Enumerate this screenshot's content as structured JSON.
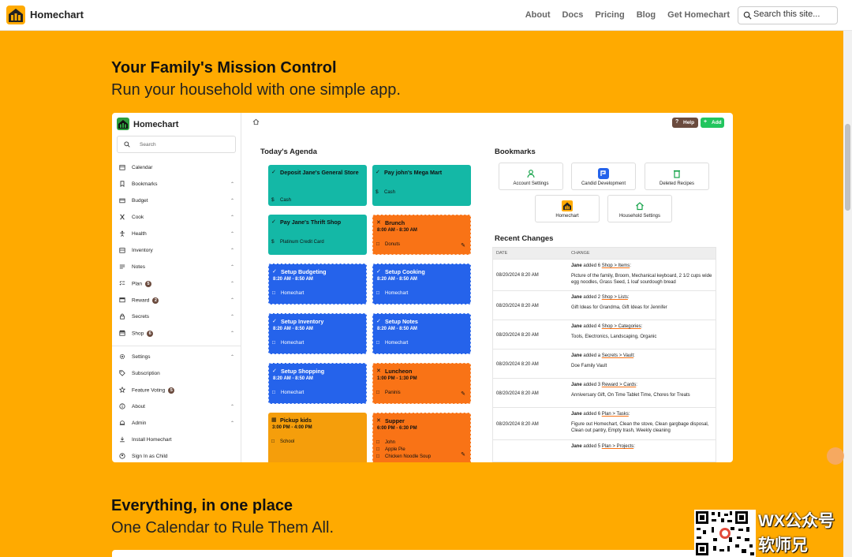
{
  "site": {
    "brand": "Homechart",
    "nav": [
      "About",
      "Docs",
      "Pricing",
      "Blog",
      "Get Homechart"
    ],
    "search_placeholder": "Search this site..."
  },
  "hero": {
    "title": "Your Family's Mission Control",
    "subtitle": "Run your household with one simple app."
  },
  "section2": {
    "title": "Everything, in one place",
    "subtitle": "One Calendar to Rule Them All."
  },
  "app": {
    "brand": "Homechart",
    "search": "Search",
    "help_label": "Help",
    "add_label": "Add",
    "sidebar": [
      {
        "label": "Calendar",
        "icon": "calendar-icon",
        "chev": false,
        "badge": ""
      },
      {
        "label": "Bookmarks",
        "icon": "bookmark-icon",
        "chev": true,
        "badge": ""
      },
      {
        "label": "Budget",
        "icon": "budget-icon",
        "chev": true,
        "badge": ""
      },
      {
        "label": "Cook",
        "icon": "utensils-icon",
        "chev": true,
        "badge": ""
      },
      {
        "label": "Health",
        "icon": "health-icon",
        "chev": true,
        "badge": ""
      },
      {
        "label": "Inventory",
        "icon": "inventory-icon",
        "chev": true,
        "badge": ""
      },
      {
        "label": "Notes",
        "icon": "notes-icon",
        "chev": true,
        "badge": ""
      },
      {
        "label": "Plan",
        "icon": "plan-icon",
        "chev": true,
        "badge": "5"
      },
      {
        "label": "Reward",
        "icon": "reward-icon",
        "chev": true,
        "badge": "2"
      },
      {
        "label": "Secrets",
        "icon": "lock-icon",
        "chev": true,
        "badge": ""
      },
      {
        "label": "Shop",
        "icon": "shop-icon",
        "chev": true,
        "badge": "6"
      },
      {
        "label": "Settings",
        "icon": "gear-icon",
        "chev": true,
        "badge": ""
      },
      {
        "label": "Subscription",
        "icon": "tag-icon",
        "chev": false,
        "badge": ""
      },
      {
        "label": "Feature Voting",
        "icon": "star-icon",
        "chev": false,
        "badge": "5"
      },
      {
        "label": "About",
        "icon": "info-icon",
        "chev": true,
        "badge": ""
      },
      {
        "label": "Admin",
        "icon": "admin-icon",
        "chev": true,
        "badge": ""
      },
      {
        "label": "Install Homechart",
        "icon": "download-icon",
        "chev": false,
        "badge": ""
      },
      {
        "label": "Sign In as Child",
        "icon": "child-icon",
        "chev": false,
        "badge": ""
      }
    ],
    "agenda": {
      "title": "Today's Agenda",
      "cards": [
        {
          "title": "Deposit Jane's General Store",
          "time": "",
          "lines": [
            "Cash"
          ],
          "color": "teal"
        },
        {
          "title": "Pay john's Mega Mart",
          "time": "",
          "lines": [
            "Cash"
          ],
          "color": "teal"
        },
        {
          "title": "Pay Jane's Thrift Shop",
          "time": "",
          "lines": [
            "Platinum Credit Card"
          ],
          "color": "teal"
        },
        {
          "title": "Brunch",
          "time": "8:00 AM - 8:30 AM",
          "lines": [
            "Donuts"
          ],
          "color": "orange"
        },
        {
          "title": "Setup Budgeting",
          "time": "8:20 AM - 8:50 AM",
          "lines": [
            "Homechart"
          ],
          "color": "blue"
        },
        {
          "title": "Setup Cooking",
          "time": "8:20 AM - 8:50 AM",
          "lines": [
            "Homechart"
          ],
          "color": "blue"
        },
        {
          "title": "Setup Inventory",
          "time": "8:20 AM - 8:50 AM",
          "lines": [
            "Homechart"
          ],
          "color": "blue"
        },
        {
          "title": "Setup Notes",
          "time": "8:20 AM - 8:50 AM",
          "lines": [
            "Homechart"
          ],
          "color": "blue"
        },
        {
          "title": "Setup Shopping",
          "time": "8:20 AM - 8:50 AM",
          "lines": [
            "Homechart"
          ],
          "color": "blue"
        },
        {
          "title": "Luncheon",
          "time": "1:00 PM - 1:30 PM",
          "lines": [
            "Paninis"
          ],
          "color": "orange"
        },
        {
          "title": "Pickup kids",
          "time": "3:00 PM - 4:00 PM",
          "lines": [
            "School"
          ],
          "color": "yellow"
        },
        {
          "title": "Supper",
          "time": "6:00 PM - 6:30 PM",
          "lines": [
            "John",
            "Apple Pie",
            "Chicken Noodle Soup"
          ],
          "color": "orange"
        }
      ]
    },
    "bookmarks": {
      "title": "Bookmarks",
      "items": [
        {
          "label": "Account Settings",
          "icon": "user-icon"
        },
        {
          "label": "Candid Development",
          "icon": "candid-icon"
        },
        {
          "label": "Deleted Recipes",
          "icon": "trash-icon"
        },
        {
          "label": "Homechart",
          "icon": "homechart-logo-icon"
        },
        {
          "label": "Household Settings",
          "icon": "house-icon"
        }
      ]
    },
    "recent": {
      "title": "Recent Changes",
      "col_date": "DATE",
      "col_change": "CHANGE",
      "rows": [
        {
          "date": "08/20/2024 8:20 AM",
          "who": "Jane",
          "verb": "added 6",
          "link": "Shop > Items",
          "details": "Picture of the family, Broom, Mechanical keyboard, 2 1/2 cups wide egg noodles, Grass Seed, 1 loaf sourdough bread"
        },
        {
          "date": "08/20/2024 8:20 AM",
          "who": "Jane",
          "verb": "added 2",
          "link": "Shop > Lists",
          "details": "Gift Ideas for Grandma, Gift Ideas for Jennifer"
        },
        {
          "date": "08/20/2024 8:20 AM",
          "who": "Jane",
          "verb": "added 4",
          "link": "Shop > Categories",
          "details": "Tools, Electronics, Landscaping, Organic"
        },
        {
          "date": "08/20/2024 8:20 AM",
          "who": "Jane",
          "verb": "added a",
          "link": "Secrets > Vault",
          "details": "Doe Family Vault"
        },
        {
          "date": "08/20/2024 8:20 AM",
          "who": "Jane",
          "verb": "added 3",
          "link": "Reward > Cards",
          "details": "Anniversary Gift, On Time Tablet Time, Chores for Treats"
        },
        {
          "date": "08/20/2024 8:20 AM",
          "who": "Jane",
          "verb": "added 6",
          "link": "Plan > Tasks",
          "details": "Figure out Homechart, Clean the stove, Clean gargbage disposal, Clean out pantry, Empty trash, Weekly cleaning"
        },
        {
          "date": "",
          "who": "Jane",
          "verb": "added 5",
          "link": "Plan > Projects",
          "details": ""
        }
      ]
    }
  },
  "watermark": {
    "line1": "WX公众号",
    "line2": "软师兄"
  }
}
